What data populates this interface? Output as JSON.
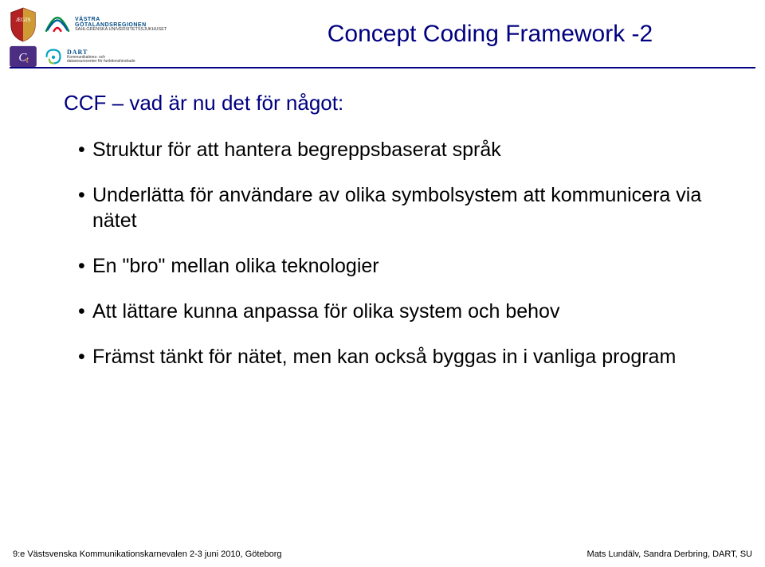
{
  "header": {
    "title": "Concept Coding Framework -2",
    "logos": {
      "vastra_line1": "VÄSTRA",
      "vastra_line2": "GÖTALANDSREGIONEN",
      "vastra_sub": "SAHLGRENSKA UNIVERSITETSSJUKHUSET",
      "dart_title": "DART",
      "dart_sub1": "Kommunikations- och",
      "dart_sub2": "dataresurscenter för funktionshindrade"
    }
  },
  "content": {
    "subtitle": "CCF – vad är nu det för något:",
    "bullets": [
      "Struktur för att hantera begreppsbaserat språk",
      "Underlätta för användare av olika symbolsystem att kommunicera via nätet",
      "En \"bro\" mellan olika teknologier",
      "Att lättare kunna anpassa för olika system och behov",
      "Främst tänkt för nätet, men kan också byggas in i vanliga program"
    ]
  },
  "footer": {
    "left": "9:e Västsvenska Kommunikationskarnevalen 2-3 juni 2010, Göteborg",
    "right": "Mats Lundälv, Sandra Derbring, DART, SU"
  }
}
